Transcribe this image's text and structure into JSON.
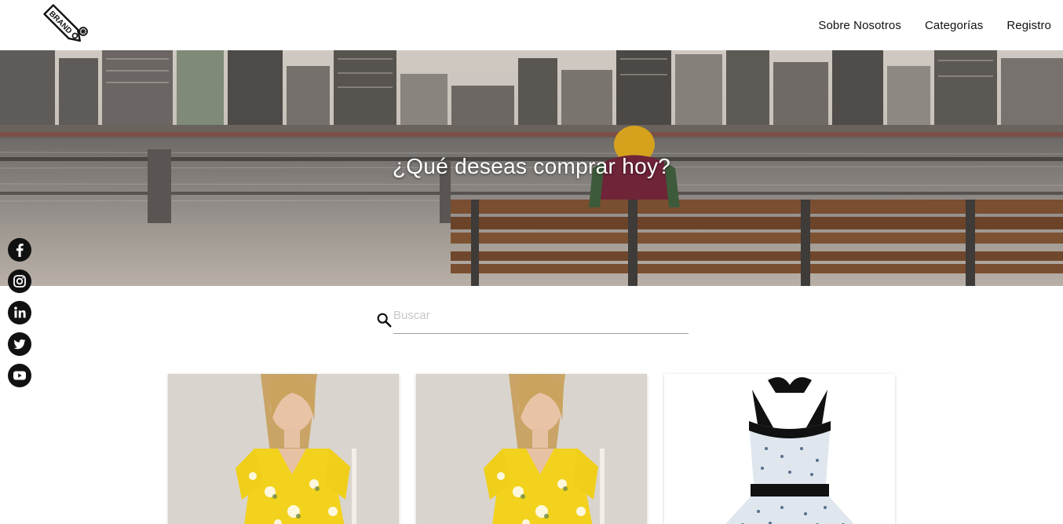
{
  "header": {
    "logo_text": "BRAND",
    "nav": [
      {
        "label": "Sobre Nosotros"
      },
      {
        "label": "Categorías"
      },
      {
        "label": "Registro"
      }
    ]
  },
  "hero": {
    "title": "¿Qué deseas comprar hoy?"
  },
  "social": [
    "facebook-icon",
    "instagram-icon",
    "linkedin-icon",
    "twitter-icon",
    "youtube-icon"
  ],
  "search": {
    "placeholder": "Buscar",
    "value": ""
  },
  "products": [
    {
      "image": "yellow-floral-cold-shoulder-dress"
    },
    {
      "image": "yellow-floral-cold-shoulder-dress"
    },
    {
      "image": "halter-polka-dot-swing-dress"
    }
  ],
  "colors": {
    "background": "#ffffff",
    "text": "#111111",
    "hero_text": "#ffffff",
    "icon": "#111111"
  }
}
